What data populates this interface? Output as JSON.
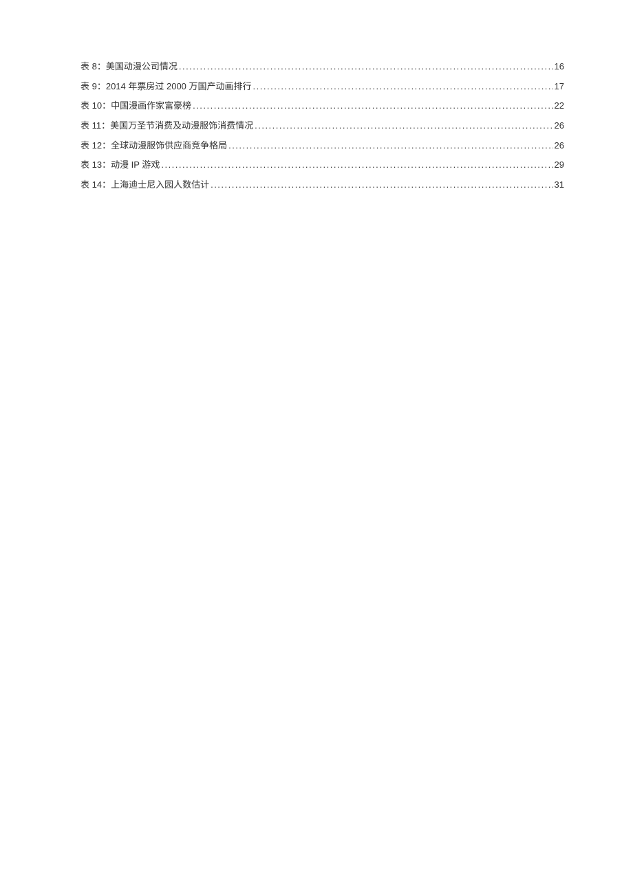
{
  "toc": {
    "entries": [
      {
        "title": "表 8：美国动漫公司情况",
        "page": "16"
      },
      {
        "title": "表 9：2014 年票房过 2000 万国产动画排行 ",
        "page": "17"
      },
      {
        "title": "表 10：中国漫画作家富豪榜 ",
        "page": "22"
      },
      {
        "title": "表 11：美国万圣节消费及动漫服饰消费情况 ",
        "page": "26"
      },
      {
        "title": "表 12：全球动漫服饰供应商竞争格局",
        "page": "26"
      },
      {
        "title": "表 13：动漫 IP 游戏",
        "page": "29"
      },
      {
        "title": "表 14：上海迪士尼入园人数估计 ",
        "page": "31"
      }
    ]
  }
}
